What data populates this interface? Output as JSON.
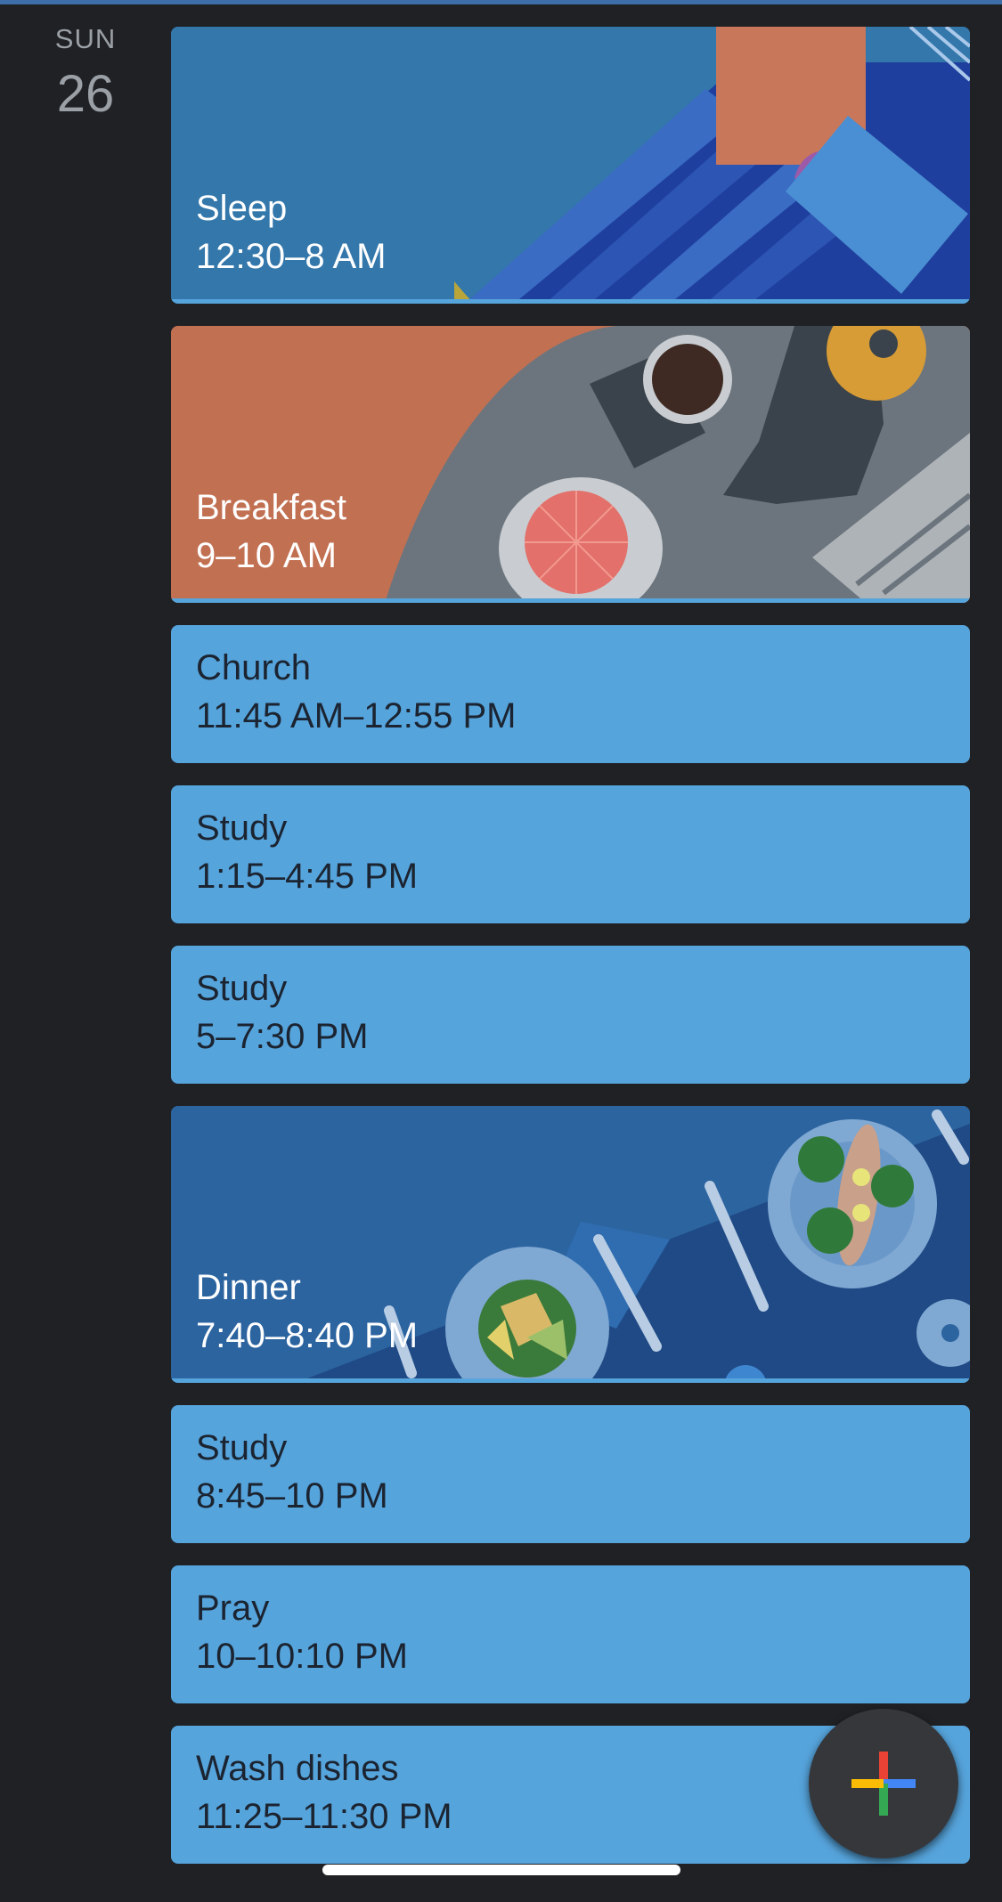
{
  "day": {
    "weekday": "SUN",
    "date": "26"
  },
  "events": [
    {
      "title": "Sleep",
      "time": "12:30–8 AM",
      "illustration": "sleep-illustration"
    },
    {
      "title": "Breakfast",
      "time": "9–10 AM",
      "illustration": "breakfast-illustration"
    },
    {
      "title": "Church",
      "time": "11:45 AM–12:55 PM"
    },
    {
      "title": "Study",
      "time": "1:15–4:45 PM"
    },
    {
      "title": "Study",
      "time": "5–7:30 PM"
    },
    {
      "title": "Dinner",
      "time": "7:40–8:40 PM",
      "illustration": "dinner-illustration"
    },
    {
      "title": "Study",
      "time": "8:45–10 PM"
    },
    {
      "title": "Pray",
      "time": "10–10:10 PM"
    },
    {
      "title": "Wash dishes",
      "time": "11:25–11:30 PM"
    }
  ],
  "fab": {
    "icon": "plus-icon",
    "colors": [
      "#ea4335",
      "#4285f4",
      "#34a853",
      "#fbbc05"
    ]
  },
  "colors": {
    "background": "#202124",
    "event": "#56a4dc",
    "text_dark": "#1b2430"
  }
}
